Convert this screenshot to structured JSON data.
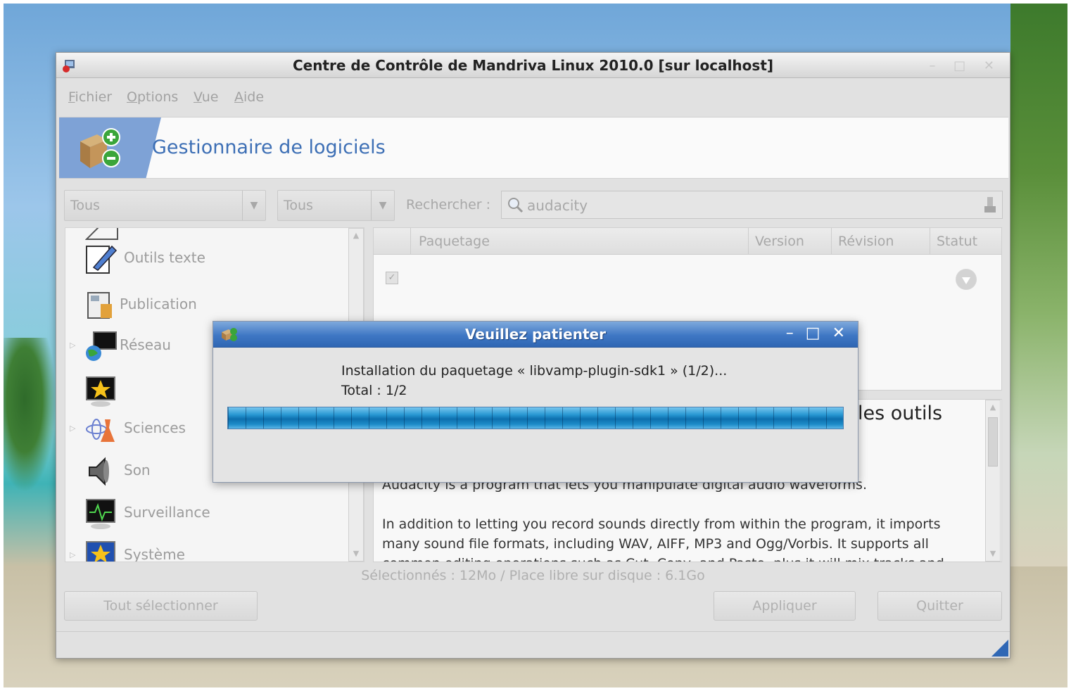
{
  "window": {
    "title": "Centre de Contrôle de Mandriva Linux 2010.0 [sur localhost]",
    "wm_buttons": "– □ ✕"
  },
  "menu": [
    "Fichier",
    "Options",
    "Vue",
    "Aide"
  ],
  "banner": {
    "title": "Gestionnaire de logiciels"
  },
  "filters": {
    "combo1": "Tous",
    "combo2": "Tous",
    "search_label": "Rechercher :",
    "search_value": "audacity"
  },
  "categories": [
    {
      "label": "Outils texte",
      "expandable": false,
      "icon": "text-tools-icon"
    },
    {
      "label": "Publication",
      "expandable": false,
      "icon": "publishing-icon"
    },
    {
      "label": "Réseau",
      "expandable": true,
      "icon": "network-icon"
    },
    {
      "label": "",
      "expandable": false,
      "icon": "star-screen-icon"
    },
    {
      "label": "Sciences",
      "expandable": true,
      "icon": "science-icon"
    },
    {
      "label": "Son",
      "expandable": false,
      "icon": "speaker-icon"
    },
    {
      "label": "Surveillance",
      "expandable": false,
      "icon": "monitoring-icon"
    },
    {
      "label": "Système",
      "expandable": true,
      "icon": "system-icon"
    }
  ],
  "package_list": {
    "columns": [
      "Paquetage",
      "Version",
      "Révision",
      "Statut"
    ]
  },
  "description": {
    "title_fragment": "les outils",
    "line1": "Audacity is a program that lets you manipulate digital audio waveforms.",
    "line2": "In addition to letting you record sounds directly from within the program, it imports many sound file formats, including WAV, AIFF, MP3 and Ogg/Vorbis. It supports all common editing operations such as Cut, Copy, and Paste, plus it will mix tracks and"
  },
  "selection_info": "Sélectionnés : 12Mo / Place libre sur disque : 6.1Go",
  "buttons": {
    "select_all": "Tout sélectionner",
    "apply": "Appliquer",
    "quit": "Quitter"
  },
  "dialog": {
    "title": "Veuillez patienter",
    "message": "Installation du paquetage « libvamp-plugin-sdk1 » (1/2)...",
    "total": "Total : 1/2",
    "progress": 1.0,
    "buttons": [
      "–",
      "□",
      "✕"
    ]
  },
  "colors": {
    "accent": "#3d6fb5",
    "dialog_title": "#3f77c4",
    "progress": "#1c8cc8"
  }
}
